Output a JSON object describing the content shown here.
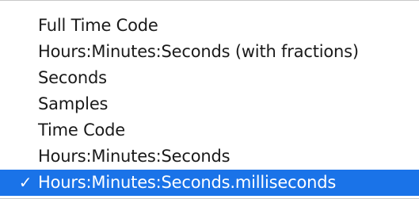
{
  "menu": {
    "items": [
      {
        "label": "Full Time Code",
        "checked": false
      },
      {
        "label": "Hours:Minutes:Seconds (with fractions)",
        "checked": false
      },
      {
        "label": "Seconds",
        "checked": false
      },
      {
        "label": "Samples",
        "checked": false
      },
      {
        "label": "Time Code",
        "checked": false
      },
      {
        "label": "Hours:Minutes:Seconds",
        "checked": false
      },
      {
        "label": "Hours:Minutes:Seconds.milliseconds",
        "checked": true
      }
    ],
    "check_glyph": "✓",
    "colors": {
      "highlight": "#1a73e8",
      "text": "#1a1a1a",
      "highlight_text": "#ffffff",
      "background": "#ffffff"
    }
  }
}
